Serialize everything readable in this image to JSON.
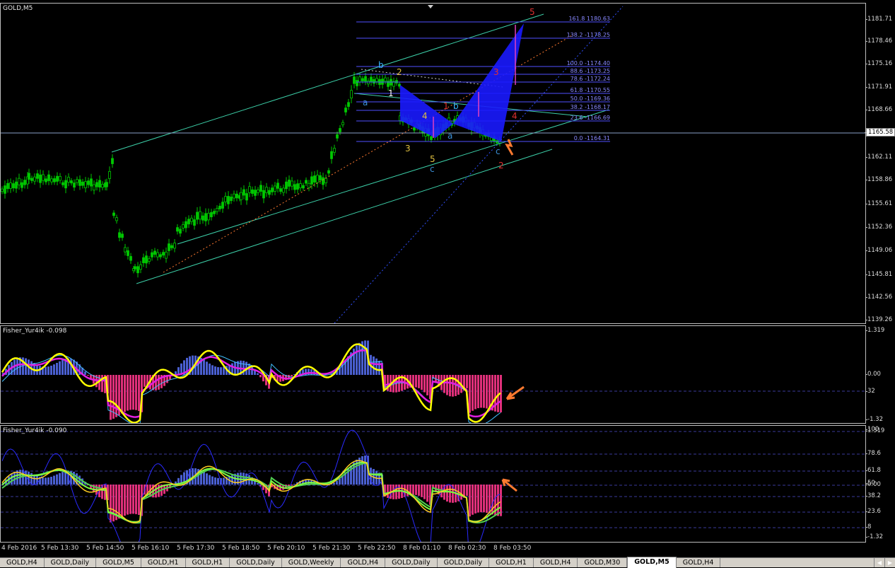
{
  "main": {
    "title": "GOLD,M5",
    "price_ticks": [
      "1181.71",
      "1178.46",
      "1175.16",
      "1171.91",
      "1168.66",
      "1165.58",
      "1162.11",
      "1158.86",
      "1155.61",
      "1152.36",
      "1149.06",
      "1145.81",
      "1142.56",
      "1139.26"
    ],
    "current_price": "1165.58",
    "fib_labels": [
      "161.8 1180.63",
      "138.2 -1178.25",
      "100.0 -1174.40",
      "88.6 -1173.25",
      "78.6 -1172.24",
      "61.8 -1170.55",
      "50.0 -1169.36",
      "38.2 -1168.17",
      "23.6 -1166.69",
      "0.0 -1164.31"
    ],
    "wave_labels": [
      {
        "text": "5",
        "color": "#e03030"
      },
      {
        "text": "b",
        "color": "#39b6ff"
      },
      {
        "text": "2",
        "color": "#e0c040"
      },
      {
        "text": "1",
        "color": "#ffffff"
      },
      {
        "text": "a",
        "color": "#3a8fd6"
      },
      {
        "text": "3",
        "color": "#e03030"
      },
      {
        "text": "4",
        "color": "#e0c040"
      },
      {
        "text": "1",
        "color": "#e03030"
      },
      {
        "text": "b",
        "color": "#39b6ff"
      },
      {
        "text": "4",
        "color": "#e03030"
      },
      {
        "text": "3",
        "color": "#e0c040"
      },
      {
        "text": "a",
        "color": "#3a8fd6"
      },
      {
        "text": "5",
        "color": "#e0c040"
      },
      {
        "text": "c",
        "color": "#3a8fd6"
      },
      {
        "text": "c",
        "color": "#3a8fd6"
      },
      {
        "text": "2",
        "color": "#e03030"
      }
    ]
  },
  "indicator1": {
    "title": "Fisher_Yur4ik -0.098",
    "ticks": [
      "1.319",
      "0.00",
      "32",
      "-1.32"
    ]
  },
  "indicator2": {
    "title": "Fisher_Yur4ik -0.090",
    "ticks": [
      "100",
      "1.319",
      "78.6",
      "61.8",
      "50",
      "0.00",
      "38.2",
      "23.6",
      "8",
      "-1.32"
    ]
  },
  "time_ticks": [
    "4 Feb 2016",
    "5 Feb 13:30",
    "5 Feb 14:50",
    "5 Feb 16:10",
    "5 Feb 17:30",
    "5 Feb 18:50",
    "5 Feb 20:10",
    "5 Feb 21:30",
    "5 Feb 22:50",
    "8 Feb 01:10",
    "8 Feb 02:30",
    "8 Feb 03:50"
  ],
  "tabs": [
    "GOLD,H4",
    "GOLD,Daily",
    "GOLD,M5",
    "GOLD,H1",
    "GOLD,H1",
    "GOLD,Daily",
    "GOLD,Weekly",
    "GOLD,H4",
    "GOLD,Daily",
    "GOLD,Daily",
    "GOLD,H1",
    "GOLD,H4",
    "GOLD,M30",
    "GOLD,M5",
    "GOLD,H4"
  ],
  "active_tab": 13,
  "colors": {
    "candle": "#00c800",
    "channel": "#3ccfa8",
    "fib": "#5050ff",
    "pattern": "#1a1aff",
    "hist_pos": "#4a5fd0",
    "hist_neg": "#e0307a",
    "fisher": "#ffff00",
    "signal": "#e020e0",
    "arrow": "#ff7a30"
  }
}
